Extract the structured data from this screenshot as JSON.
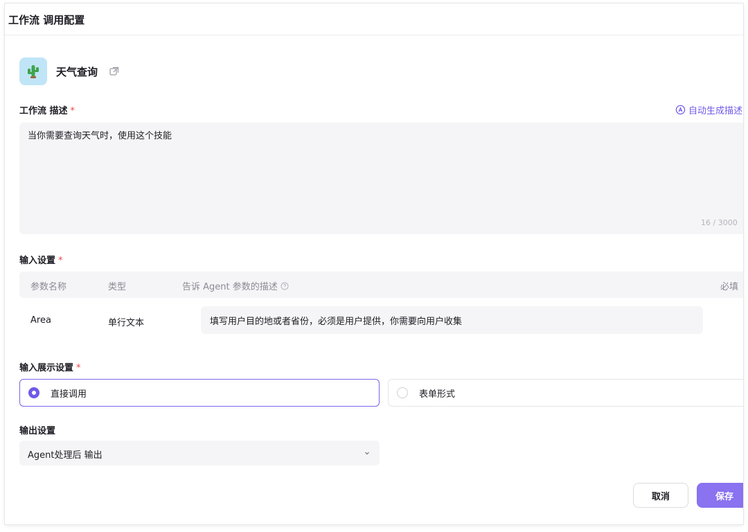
{
  "dialog": {
    "title": "工作流 调用配置"
  },
  "workflow": {
    "name": "天气查询",
    "icon": "cactus-icon"
  },
  "description": {
    "label": "工作流 描述",
    "required_mark": "*",
    "auto_generate_label": "自动生成描述",
    "value": "当你需要查询天气时，使用这个技能",
    "counter": "16 / 3000"
  },
  "input_settings": {
    "label": "输入设置",
    "required_mark": "*",
    "columns": [
      "参数名称",
      "类型",
      "告诉 Agent 参数的描述",
      "必填"
    ],
    "rows": [
      {
        "name": "Area",
        "type": "单行文本",
        "description": "填写用户目的地或者省份，必须是用户提供，你需要向用户收集"
      }
    ]
  },
  "display_settings": {
    "label": "输入展示设置",
    "required_mark": "*",
    "options": [
      {
        "label": "直接调用",
        "selected": true
      },
      {
        "label": "表单形式",
        "selected": false
      }
    ]
  },
  "output_settings": {
    "label": "输出设置",
    "selected": "Agent处理后 输出"
  },
  "actions": {
    "cancel": "取消",
    "save": "保存"
  },
  "colors": {
    "accent": "#6f5ae8",
    "required": "#f04444",
    "field_bg": "#f5f5f7"
  }
}
